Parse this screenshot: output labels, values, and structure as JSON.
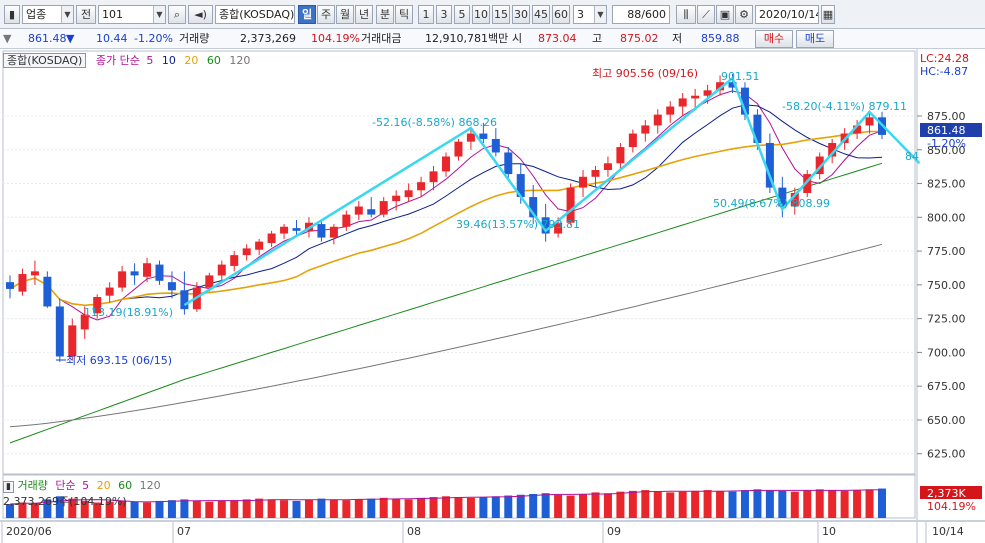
{
  "toolbar": {
    "market": "업종",
    "mode": "전",
    "code": "101",
    "index_name": "종합(KOSDAQ)",
    "period_tabs": [
      "일",
      "주",
      "월",
      "년",
      "분",
      "틱"
    ],
    "active_period": "일",
    "intervals": [
      "1",
      "3",
      "5",
      "10",
      "15",
      "30",
      "45",
      "60"
    ],
    "interval_select": "3",
    "count": "88/600",
    "date": "2020/10/14"
  },
  "quote": {
    "price": "861.48",
    "arrow": "▼",
    "change": "10.44",
    "change_pct": "-1.20%",
    "volume_label": "거래량",
    "volume": "2,373,269",
    "volume_pct": "104.19%",
    "amount_label": "거래대금",
    "amount": "12,910,781백만",
    "open_label": "시",
    "open": "873.04",
    "high_label": "고",
    "high": "875.02",
    "low_label": "저",
    "low": "859.88",
    "buy_button": "매수",
    "sell_button": "매도"
  },
  "legend": {
    "name": "종합(KOSDAQ)",
    "series": "종가 단순",
    "ma": [
      "5",
      "10",
      "20",
      "60",
      "120"
    ],
    "ma_colors": [
      "#b0129a",
      "#0b1e8a",
      "#e6a20a",
      "#1a8a1a",
      "#777777"
    ]
  },
  "volume_legend": {
    "label": "거래량",
    "series": "단순",
    "ma": [
      "5",
      "20",
      "60",
      "120"
    ],
    "value": "2,373,269주(104.19%)"
  },
  "side_labels": {
    "lc": "LC:24.28",
    "hc": "HC:-4.87",
    "price_tag": "861.48",
    "pct_tag": "-1.20%",
    "vol_tag": "2,373K",
    "vol_pct_tag": "104.19%"
  },
  "annotations": {
    "high": "최고 905.56 (09/16)",
    "low": "최저 693.15 (06/15)",
    "wave1": "-52.16(-8.58%) 868.26",
    "wave2": "39.46(13.57%) 793.81",
    "wave3": "50.49(8.67%) 808.99",
    "wave4": "-58.20(-4.11%) 879.11",
    "wave5": "113.19(18.91%)",
    "wave6": "901.51",
    "wave7": "84"
  },
  "colors": {
    "up": "#e8262b",
    "down": "#1f5fd6",
    "trend": "#39d8f0"
  },
  "chart_data": {
    "type": "candlestick",
    "x_ticks": [
      "2020/06",
      "07",
      "08",
      "09",
      "10",
      "10/14"
    ],
    "y_ticks": [
      625,
      650,
      675,
      700,
      725,
      750,
      775,
      800,
      825,
      850,
      875
    ],
    "ylim": [
      610,
      912
    ],
    "volume_ticks": [],
    "candles": [
      [
        752,
        757,
        740,
        747
      ],
      [
        745,
        762,
        742,
        758
      ],
      [
        757,
        768,
        750,
        760
      ],
      [
        756,
        760,
        733,
        734
      ],
      [
        734,
        740,
        693,
        697
      ],
      [
        697,
        725,
        694,
        720
      ],
      [
        717,
        734,
        710,
        728
      ],
      [
        729,
        743,
        725,
        741
      ],
      [
        742,
        752,
        737,
        748
      ],
      [
        748,
        764,
        745,
        760
      ],
      [
        760,
        766,
        750,
        757
      ],
      [
        756,
        770,
        752,
        766
      ],
      [
        765,
        768,
        750,
        753
      ],
      [
        752,
        760,
        740,
        746
      ],
      [
        746,
        760,
        728,
        732
      ],
      [
        732,
        752,
        730,
        748
      ],
      [
        748,
        759,
        745,
        757
      ],
      [
        757,
        768,
        752,
        765
      ],
      [
        764,
        775,
        760,
        772
      ],
      [
        772,
        780,
        768,
        777
      ],
      [
        776,
        784,
        772,
        782
      ],
      [
        781,
        790,
        778,
        788
      ],
      [
        788,
        795,
        784,
        793
      ],
      [
        792,
        798,
        786,
        790
      ],
      [
        790,
        800,
        785,
        796
      ],
      [
        795,
        798,
        782,
        785
      ],
      [
        785,
        795,
        780,
        793
      ],
      [
        793,
        805,
        790,
        802
      ],
      [
        802,
        812,
        798,
        808
      ],
      [
        806,
        815,
        800,
        802
      ],
      [
        802,
        815,
        800,
        812
      ],
      [
        812,
        820,
        805,
        816
      ],
      [
        815,
        825,
        812,
        820
      ],
      [
        820,
        830,
        815,
        826
      ],
      [
        826,
        838,
        820,
        834
      ],
      [
        834,
        848,
        830,
        845
      ],
      [
        845,
        858,
        842,
        856
      ],
      [
        856,
        866,
        850,
        862
      ],
      [
        862,
        870,
        855,
        858
      ],
      [
        858,
        866,
        845,
        848
      ],
      [
        848,
        852,
        828,
        832
      ],
      [
        832,
        840,
        810,
        815
      ],
      [
        815,
        824,
        795,
        800
      ],
      [
        800,
        810,
        782,
        788
      ],
      [
        788,
        800,
        785,
        796
      ],
      [
        796,
        825,
        794,
        822
      ],
      [
        822,
        835,
        815,
        830
      ],
      [
        830,
        838,
        822,
        835
      ],
      [
        835,
        845,
        830,
        840
      ],
      [
        840,
        855,
        836,
        852
      ],
      [
        852,
        865,
        848,
        862
      ],
      [
        862,
        872,
        856,
        868
      ],
      [
        868,
        880,
        862,
        876
      ],
      [
        876,
        886,
        870,
        882
      ],
      [
        882,
        892,
        875,
        888
      ],
      [
        888,
        895,
        880,
        890
      ],
      [
        890,
        898,
        884,
        894
      ],
      [
        894,
        905,
        890,
        900
      ],
      [
        900,
        906,
        892,
        896
      ],
      [
        896,
        900,
        872,
        876
      ],
      [
        876,
        880,
        850,
        855
      ],
      [
        855,
        862,
        818,
        822
      ],
      [
        822,
        830,
        800,
        808
      ],
      [
        808,
        822,
        802,
        818
      ],
      [
        818,
        835,
        815,
        832
      ],
      [
        832,
        848,
        828,
        845
      ],
      [
        845,
        858,
        840,
        855
      ],
      [
        855,
        866,
        850,
        862
      ],
      [
        862,
        872,
        858,
        868
      ],
      [
        868,
        879,
        862,
        874
      ],
      [
        874,
        878,
        858,
        861
      ]
    ],
    "volume": [
      18,
      20,
      19,
      24,
      28,
      25,
      22,
      20,
      21,
      22,
      21,
      20,
      22,
      23,
      24,
      22,
      21,
      22,
      23,
      24,
      25,
      24,
      23,
      22,
      24,
      25,
      24,
      23,
      24,
      25,
      26,
      25,
      24,
      26,
      27,
      28,
      27,
      26,
      27,
      28,
      29,
      30,
      31,
      32,
      30,
      29,
      31,
      33,
      32,
      34,
      35,
      36,
      34,
      33,
      34,
      35,
      36,
      35,
      34,
      36,
      37,
      36,
      35,
      34,
      36,
      37,
      36,
      35,
      36,
      37,
      38
    ],
    "volume_colors": [
      "d",
      "u",
      "u",
      "d",
      "d",
      "u",
      "u",
      "u",
      "u",
      "u",
      "d",
      "u",
      "d",
      "d",
      "d",
      "u",
      "u",
      "u",
      "u",
      "u",
      "u",
      "u",
      "u",
      "d",
      "u",
      "d",
      "u",
      "u",
      "u",
      "d",
      "u",
      "u",
      "u",
      "u",
      "u",
      "u",
      "u",
      "u",
      "d",
      "d",
      "d",
      "d",
      "d",
      "d",
      "u",
      "u",
      "u",
      "u",
      "u",
      "u",
      "u",
      "u",
      "u",
      "u",
      "u",
      "u",
      "u",
      "u",
      "d",
      "d",
      "d",
      "d",
      "d",
      "u",
      "u",
      "u",
      "u",
      "u",
      "u",
      "u",
      "d"
    ]
  }
}
